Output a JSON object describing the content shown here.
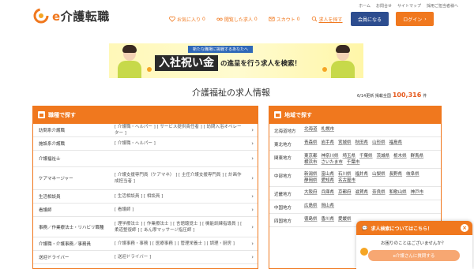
{
  "header": {
    "logo_prefix": "e",
    "logo_text": "介護転職",
    "util_links": [
      "ホーム",
      "お問合せ",
      "サイトマップ",
      "採用ご担当者様へ"
    ],
    "nav": [
      {
        "label": "お気に入り",
        "count": "0",
        "icon": "heart-icon"
      },
      {
        "label": "閲覧した求人",
        "count": "0",
        "icon": "glasses-icon"
      },
      {
        "label": "スカウト",
        "count": "0",
        "icon": "mail-icon"
      },
      {
        "label": "求人を探す",
        "icon": "search-icon"
      }
    ],
    "member_button": "会員になる",
    "login_button": "ログイン"
  },
  "banner": {
    "sub": "新たな職場に挑戦するあなたへ",
    "emphasis": "入社祝い金",
    "rest": "の進呈を行う求人を検索！"
  },
  "section": {
    "title": "介護福祉の求人情報",
    "update_label": "6/14更新 掲載全国",
    "total": "100,316",
    "unit": "件"
  },
  "occupations": {
    "header": "職種で探す",
    "rows": [
      {
        "name": "訪問系介護職",
        "subs": "[ 介護職・ヘルパー ] [ サービス提供責任者 ] [ 訪問入浴オペレーター ]"
      },
      {
        "name": "施設系介護職",
        "subs": "[ 介護職・ヘルパー ]"
      },
      {
        "name": "介護福祉士",
        "subs": ""
      },
      {
        "name": "ケアマネージャー",
        "subs": "[ 介護支援専門員（ケアマネ） ] [ 主任介護支援専門員 ] [ 計画作成担当者 ]"
      },
      {
        "name": "生活相談員",
        "subs": "[ 生活相談員 ] [ 相談員 ]"
      },
      {
        "name": "看護師",
        "subs": "[ 看護師 ]"
      },
      {
        "name": "事務／作業療法士・リハビリ職種",
        "subs": "[ 理学療法士 ] [ 作業療法士 ] [ 言語聴覚士 ] [ 機能訓練指導員 ] [ 柔道整復師 ] [ あん摩マッサージ指圧師 ]"
      },
      {
        "name": "介護職・介護事務／事務員",
        "subs": "[ 介護事務・事務 ] [ 医療事務 ] [ 管理栄養士 ] [ 調理・厨房 ]"
      },
      {
        "name": "送迎ドライバー",
        "subs": "[ 送迎ドライバー ]"
      }
    ]
  },
  "regions": {
    "header": "地域で探す",
    "rows": [
      {
        "name": "北海道地方",
        "prefs": [
          "北海道",
          "札幌市"
        ]
      },
      {
        "name": "東北地方",
        "prefs": [
          "青森県",
          "岩手県",
          "宮城県",
          "秋田県",
          "山形県",
          "福島県"
        ]
      },
      {
        "name": "関東地方",
        "prefs": [
          "東京都",
          "神奈川県",
          "埼玉県",
          "千葉県",
          "茨城県",
          "栃木県",
          "群馬県",
          "横浜市",
          "さいたま市",
          "千葉市"
        ]
      },
      {
        "name": "中部地方",
        "prefs": [
          "新潟県",
          "富山県",
          "石川県",
          "福井県",
          "山梨県",
          "長野県",
          "岐阜県",
          "静岡県",
          "愛知県",
          "名古屋市"
        ]
      },
      {
        "name": "近畿地方",
        "prefs": [
          "大阪府",
          "兵庫県",
          "京都府",
          "滋賀県",
          "奈良県",
          "和歌山県",
          "神戸市"
        ]
      },
      {
        "name": "中国地方",
        "prefs": [
          "広島県",
          "岡山県"
        ]
      },
      {
        "name": "四国地方",
        "prefs": [
          "徳島県",
          "香川県",
          "愛媛県"
        ]
      }
    ]
  },
  "chat": {
    "title": "求人検索についてはこちら！",
    "close": "×",
    "question": "お困りのことはございませんか？",
    "button": "e介護さんに質問する"
  },
  "colors": {
    "accent": "#f0781e",
    "navy": "#2d4d8f",
    "total": "#e65a1e"
  }
}
